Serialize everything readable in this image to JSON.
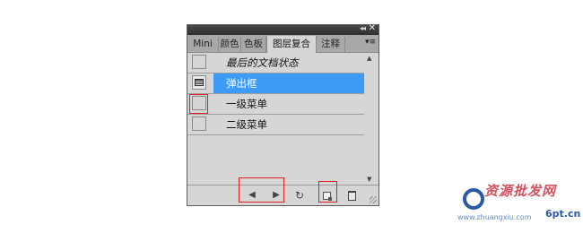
{
  "panel": {
    "titlebar": {
      "collapse_glyph": "◂◂",
      "close_glyph": "✕"
    },
    "tabs": [
      {
        "label": "Mini"
      },
      {
        "label": "颜色"
      },
      {
        "label": "色板"
      },
      {
        "label": "图层复合"
      },
      {
        "label": "注释"
      }
    ],
    "tab_menu_glyph": "▾≡",
    "rows": [
      {
        "label": "最后的文档状态"
      },
      {
        "label": "弹出框"
      },
      {
        "label": "一级菜单"
      },
      {
        "label": "二级菜单"
      }
    ],
    "scroll_up_glyph": "▲",
    "scroll_down_glyph": "▼",
    "bottom": {
      "prev_glyph": "◀",
      "next_glyph": "▶",
      "refresh_glyph": "↻"
    },
    "selected_color": "#3d9bf5",
    "highlight_color": "#e02020"
  },
  "watermark": {
    "title": "资源批发网",
    "url": "www.zhuangxiu.com",
    "tag": "6pt.cn",
    "brand_color": "#2c5aa0",
    "accent_color": "#cc3344"
  }
}
